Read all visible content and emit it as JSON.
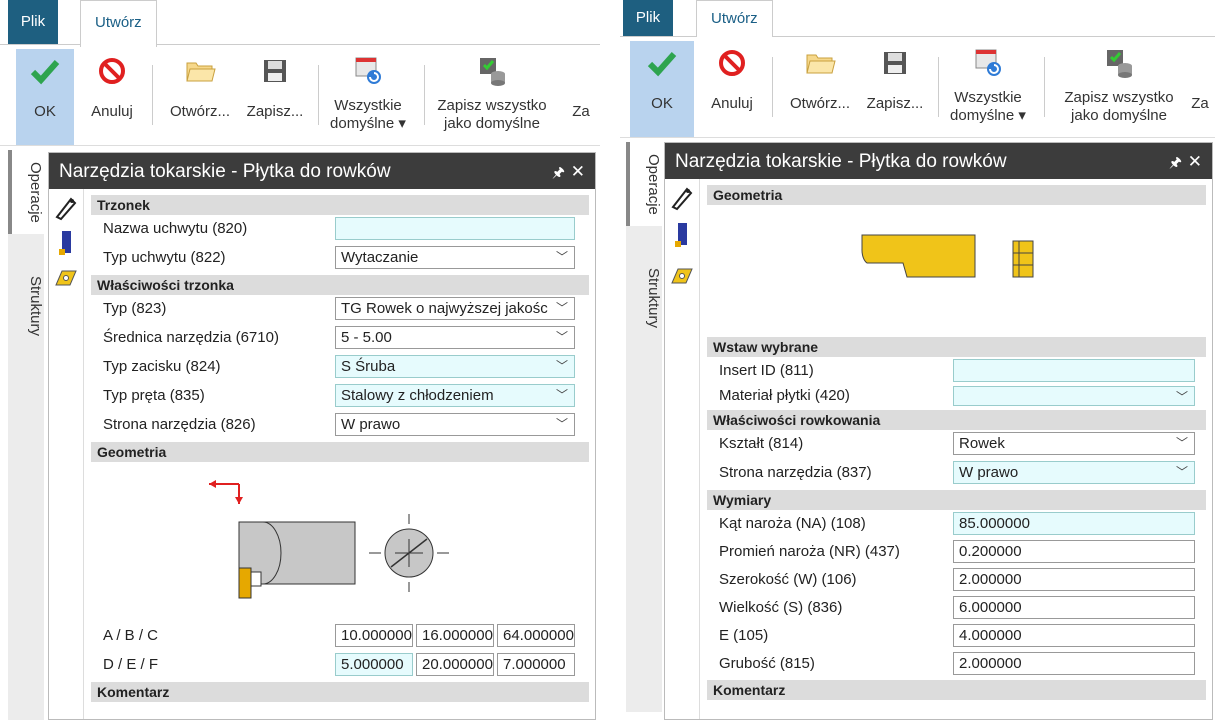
{
  "left": {
    "tabs": [
      "Plik",
      "Utwórz"
    ],
    "ribbon": {
      "ok": "OK",
      "cancel": "Anuluj",
      "open": "Otwórz...",
      "save": "Zapisz...",
      "defaults_l1": "Wszystkie",
      "defaults_l2": "domyślne ▾",
      "saveall_l1": "Zapisz wszystko",
      "saveall_l2": "jako domyślne",
      "cut": "Za"
    },
    "side_tabs": [
      "Operacje",
      "Struktury"
    ],
    "window_title": "Narzędzia tokarskie - Płytka do rowków",
    "sections": {
      "trzonek": "Trzonek",
      "wlasciwosci": "Właściwości trzonka",
      "geometria": "Geometria",
      "komentarz": "Komentarz"
    },
    "fields": {
      "nazwa_label": "Nazwa uchwytu (820)",
      "nazwa_value": "",
      "typ_uchwytu_label": "Typ uchwytu (822)",
      "typ_uchwytu_value": "Wytaczanie",
      "typ_label": "Typ (823)",
      "typ_value": "TG Rowek o najwyższej jakośc",
      "srednica_label": "Średnica narzędzia (6710)",
      "srednica_value": "5 - 5.00",
      "zacisk_label": "Typ zacisku (824)",
      "zacisk_value": "S Śruba",
      "pret_label": "Typ pręta (835)",
      "pret_value": "Stalowy z chłodzeniem",
      "strona_label": "Strona narzędzia (826)",
      "strona_value": "W prawo",
      "abc_label": "A / B / C",
      "a": "10.000000",
      "b": "16.000000",
      "c": "64.000000",
      "def_label": "D / E / F",
      "d": "5.000000",
      "e": "20.000000",
      "f": "7.000000"
    }
  },
  "right": {
    "tabs": [
      "Plik",
      "Utwórz"
    ],
    "ribbon": {
      "ok": "OK",
      "cancel": "Anuluj",
      "open": "Otwórz...",
      "save": "Zapisz...",
      "defaults_l1": "Wszystkie",
      "defaults_l2": "domyślne ▾",
      "saveall_l1": "Zapisz wszystko",
      "saveall_l2": "jako domyślne",
      "cut": "Za"
    },
    "side_tabs": [
      "Operacje",
      "Struktury"
    ],
    "window_title": "Narzędzia tokarskie - Płytka do rowków",
    "sections": {
      "geometria": "Geometria",
      "wstaw": "Wstaw wybrane",
      "rowkowania": "Właściwości rowkowania",
      "wymiary": "Wymiary",
      "komentarz": "Komentarz"
    },
    "fields": {
      "insert_label": "Insert ID (811)",
      "insert_value": "",
      "material_label": "Materiał płytki (420)",
      "material_value": "",
      "ksztalt_label": "Kształt (814)",
      "ksztalt_value": "Rowek",
      "strona_label": "Strona narzędzia (837)",
      "strona_value": "W prawo",
      "kat_label": "Kąt naroża (NA) (108)",
      "kat_value": "85.000000",
      "promien_label": "Promień naroża (NR) (437)",
      "promien_value": "0.200000",
      "szer_label": "Szerokość (W) (106)",
      "szer_value": "2.000000",
      "wielk_label": "Wielkość (S) (836)",
      "wielk_value": "6.000000",
      "e_label": "E (105)",
      "e_value": "4.000000",
      "grub_label": "Grubość (815)",
      "grub_value": "2.000000"
    }
  },
  "colors": {
    "plik_tab": "#1e5f80",
    "ok_highlight": "#b9d3ee",
    "field_highlight": "#e6fbfd",
    "header": "#3c3c3c",
    "insert_yellow": "#f0c419"
  }
}
